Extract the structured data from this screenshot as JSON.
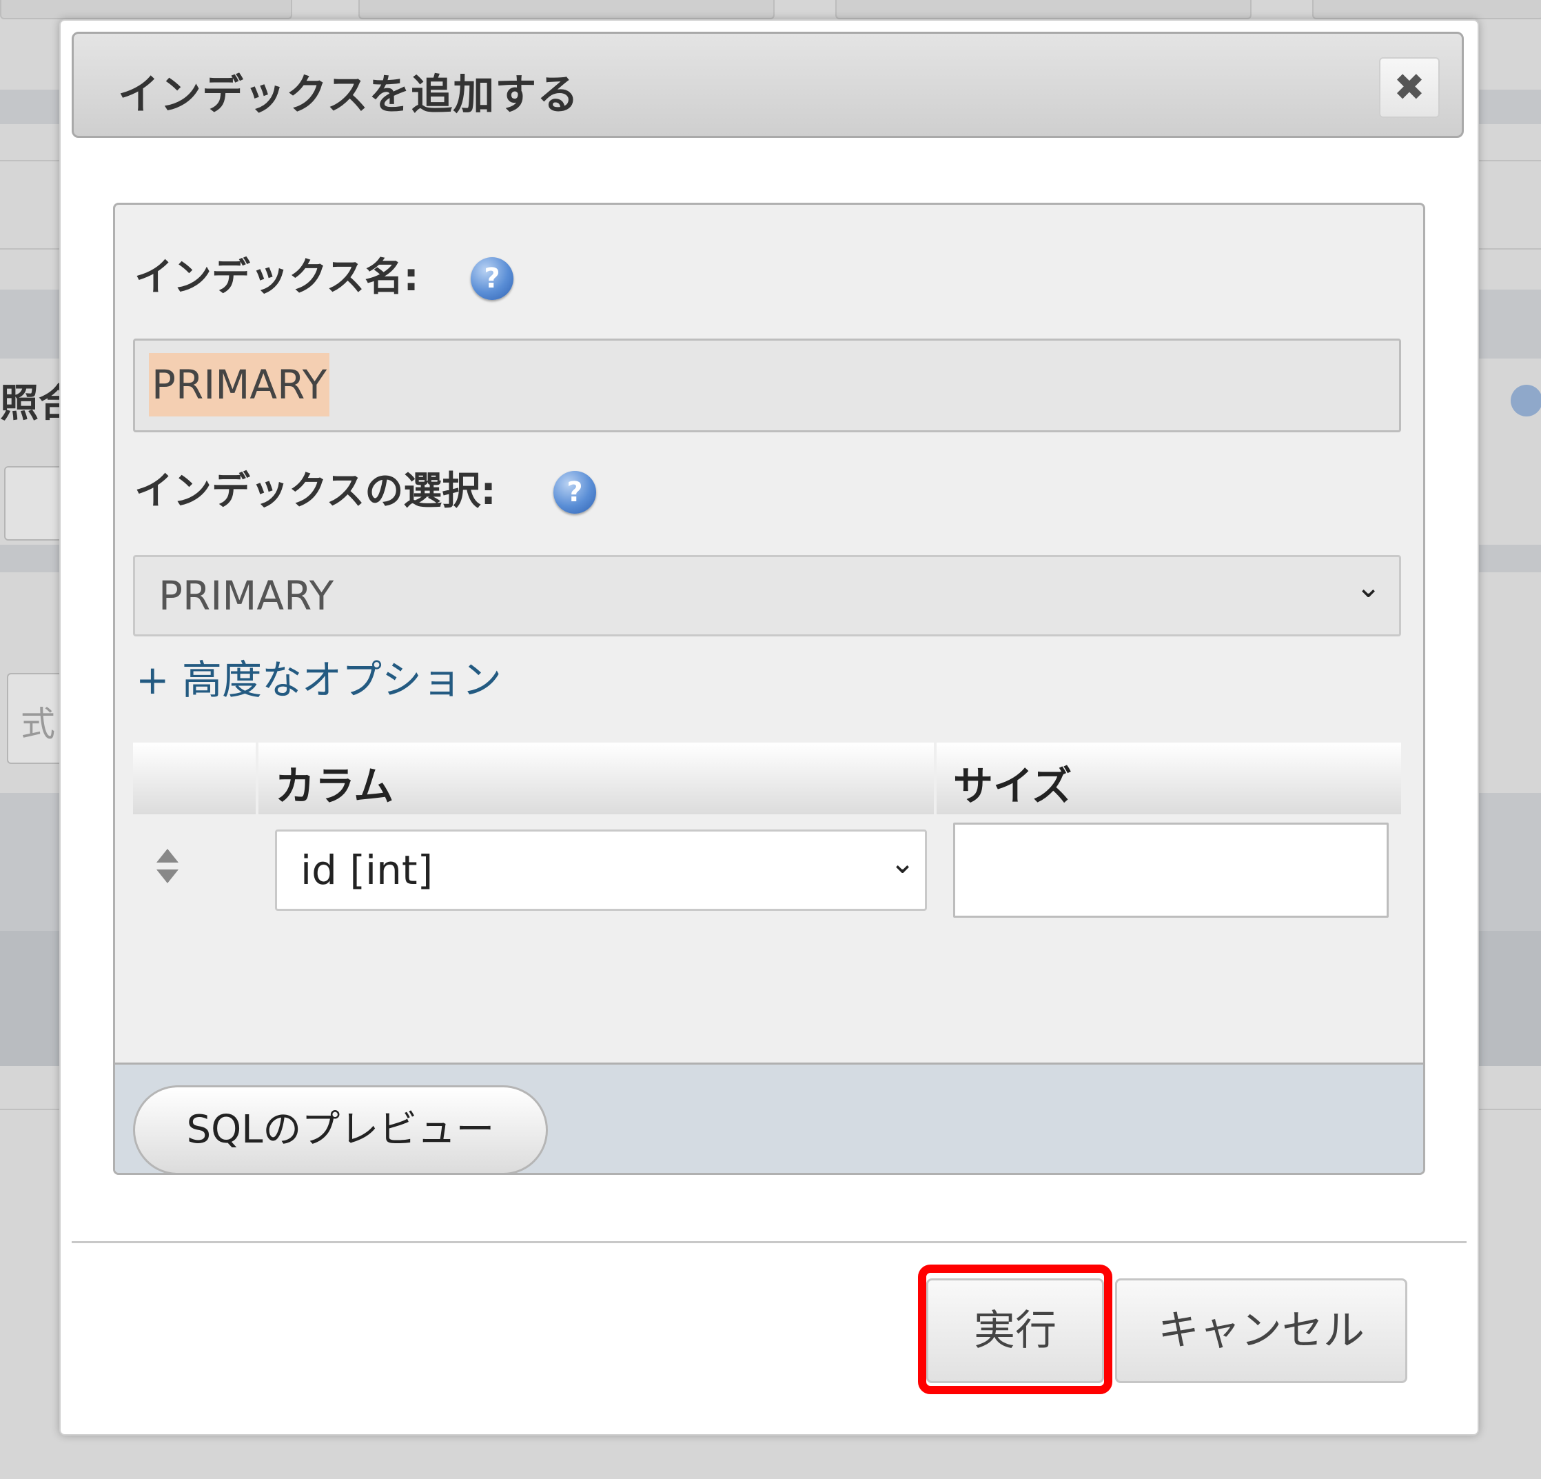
{
  "background": {
    "partial_label_1": "照合",
    "partial_label_2": "式"
  },
  "dialog": {
    "title": "インデックスを追加する",
    "close_icon": "close-icon",
    "index_name_label": "インデックス名:",
    "index_name_value": "PRIMARY",
    "index_choice_label": "インデックスの選択:",
    "index_choice_value": "PRIMARY",
    "advanced_options_link": "+ 高度なオプション",
    "table": {
      "headers": [
        "",
        "カラム",
        "サイズ"
      ],
      "rows": [
        {
          "column": "id [int]",
          "size": ""
        }
      ]
    },
    "sql_preview_button": "SQLのプレビュー",
    "execute_button": "実行",
    "cancel_button": "キャンセル",
    "help_icon_glyph": "?",
    "chevron_glyph": "⌄",
    "close_glyph": "✖"
  },
  "colors": {
    "highlight": "#ff0000",
    "link": "#235a81",
    "selection": "#f4cfb2"
  }
}
